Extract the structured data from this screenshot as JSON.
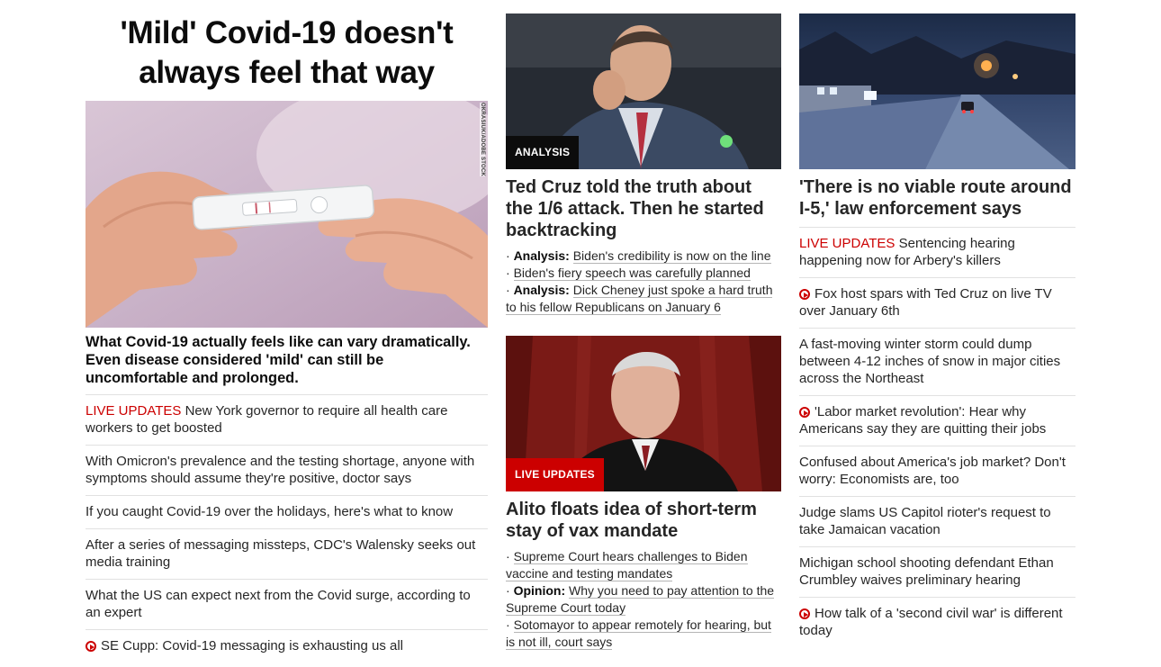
{
  "col1": {
    "hero_title_line1": "'Mild' Covid-19 doesn't",
    "hero_title_line2": "always feel that way",
    "image_credit": "OKRASIUK/ADOBE STOCK",
    "caption": "What Covid-19 actually feels like can vary dramatically. Even disease considered 'mild' can still be uncomfortable and prolonged.",
    "links": [
      {
        "prefix": "LIVE UPDATES",
        "text": "New York governor to require all health care workers to get boosted"
      },
      {
        "text": "With Omicron's prevalence and the testing shortage, anyone with symptoms should assume they're positive, doctor says"
      },
      {
        "text": "If you caught Covid-19 over the holidays, here's what to know"
      },
      {
        "text": "After a series of messaging missteps, CDC's Walensky seeks out media training"
      },
      {
        "text": "What the US can expect next from the Covid surge, according to an expert"
      },
      {
        "video": true,
        "text": "SE Cupp: Covid-19 messaging is exhausting us all"
      }
    ]
  },
  "col2": {
    "story1": {
      "badge": "ANALYSIS",
      "headline": "Ted Cruz told the truth about the 1/6 attack. Then he started backtracking",
      "bullets": [
        {
          "label": "Analysis:",
          "text": "Biden's credibility is now on the line"
        },
        {
          "text": "Biden's fiery speech was carefully planned"
        },
        {
          "label": "Analysis:",
          "text": "Dick Cheney just spoke a hard truth to his fellow Republicans on January 6"
        }
      ]
    },
    "story2": {
      "badge": "LIVE UPDATES",
      "headline": "Alito floats idea of short-term stay of vax mandate",
      "bullets": [
        {
          "text": "Supreme Court hears challenges to Biden vaccine and testing mandates"
        },
        {
          "label": "Opinion:",
          "text": "Why you need to pay attention to the Supreme Court today"
        },
        {
          "text": "Sotomayor to appear remotely for hearing, but is not ill, court says"
        }
      ]
    }
  },
  "col3": {
    "headline": "'There is no viable route around I-5,' law enforcement says",
    "links": [
      {
        "prefix": "LIVE UPDATES",
        "text": "Sentencing hearing happening now for Arbery's killers"
      },
      {
        "video": true,
        "text": "Fox host spars with Ted Cruz on live TV over January 6th"
      },
      {
        "text": "A fast-moving winter storm could dump between 4-12 inches of snow in major cities across the Northeast"
      },
      {
        "video": true,
        "text": "'Labor market revolution': Hear why Americans say they are quitting their jobs"
      },
      {
        "text": "Confused about America's job market? Don't worry: Economists are, too"
      },
      {
        "text": "Judge slams US Capitol rioter's request to take Jamaican vacation"
      },
      {
        "text": "Michigan school shooting defendant Ethan Crumbley waives preliminary hearing"
      },
      {
        "video": true,
        "text": "How talk of a 'second civil war' is different today"
      }
    ]
  },
  "colors": {
    "accent_red": "#cc0000",
    "text": "#0c0c0c",
    "divider": "#e1e1e1"
  }
}
